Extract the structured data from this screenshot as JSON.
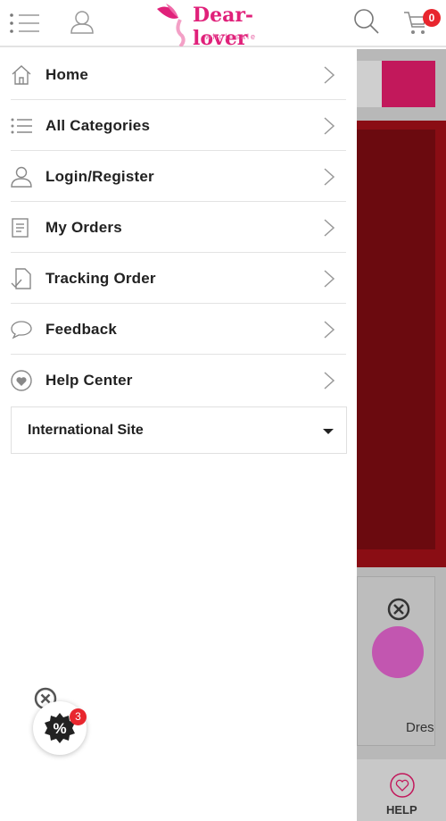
{
  "header": {
    "logo_text": "Dear-lover",
    "logo_sub": "wholesale",
    "cart_count": "0",
    "brand_color": "#e0217a"
  },
  "menu": {
    "items": [
      {
        "label": "Home",
        "icon": "home-icon"
      },
      {
        "label": "All Categories",
        "icon": "list-icon"
      },
      {
        "label": "Login/Register",
        "icon": "user-icon"
      },
      {
        "label": "My Orders",
        "icon": "orders-icon"
      },
      {
        "label": "Tracking Order",
        "icon": "tracking-icon"
      },
      {
        "label": "Feedback",
        "icon": "chat-icon"
      },
      {
        "label": "Help Center",
        "icon": "heart-icon"
      }
    ],
    "international": "International Site"
  },
  "background": {
    "product_label": "Dres",
    "help_label": "HELP"
  },
  "promo": {
    "badge_count": "3",
    "symbol": "%"
  }
}
